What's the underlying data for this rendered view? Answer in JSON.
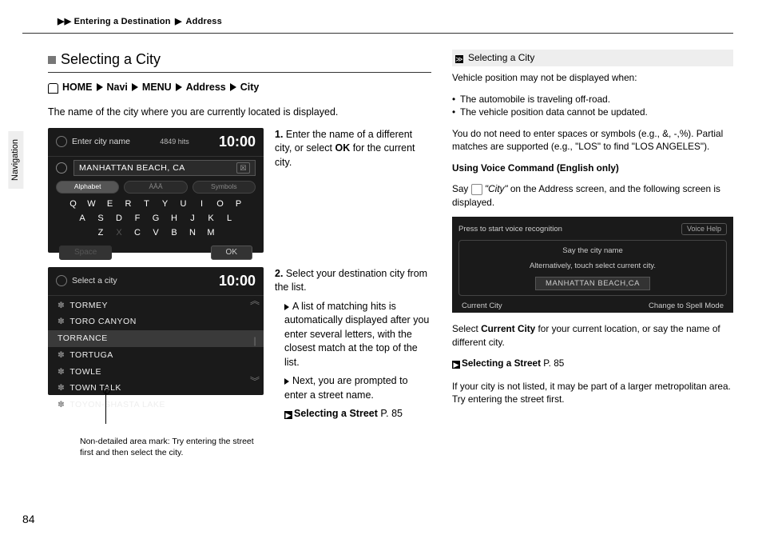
{
  "breadcrumb": {
    "arrow": "▶▶",
    "a": "Entering a Destination",
    "b": "Address",
    "sep": "▶"
  },
  "sidetab": "Navigation",
  "heading": "Selecting a City",
  "nav": {
    "home": "HOME",
    "navi": "Navi",
    "menu": "MENU",
    "addr": "Address",
    "city": "City"
  },
  "intro": "The name of the city where you are currently located is displayed.",
  "screen1": {
    "title": "Enter city name",
    "hits": "4849 hits",
    "time": "10:00",
    "city": "MANHATTAN BEACH, CA",
    "tabs": [
      "Alphabet",
      "ÀÂÄ",
      "Symbols"
    ],
    "row1": [
      "Q",
      "W",
      "E",
      "R",
      "T",
      "Y",
      "U",
      "I",
      "O",
      "P"
    ],
    "row2": [
      "A",
      "S",
      "D",
      "F",
      "G",
      "H",
      "J",
      "K",
      "L"
    ],
    "row3": [
      "Z",
      "X",
      "C",
      "V",
      "B",
      "N",
      "M"
    ],
    "space": "Space",
    "ok": "OK",
    "clear": "☒"
  },
  "step1": {
    "num": "1.",
    "a": "Enter the name of a different city, or select ",
    "b": "OK",
    "c": " for the current city."
  },
  "screen2": {
    "title": "Select a city",
    "time": "10:00",
    "items": [
      "TORMEY",
      "TORO CANYON",
      "TORRANCE",
      "TORTUGA",
      "TOWLE",
      "TOWN TALK",
      "TOYON-SHASTA LAKE"
    ],
    "star": "✽"
  },
  "step2": {
    "num": "2.",
    "a": "Select your destination city from the list.",
    "b": "A list of matching hits is automatically displayed after you enter several letters, with the closest match at the top of the list.",
    "c": "Next, you are prompted to enter a street name.",
    "xref": "Selecting a Street",
    "page": "P. 85"
  },
  "note": "Non-detailed area mark: Try entering the street first and then select the city.",
  "right": {
    "head": "Selecting a City",
    "p1": "Vehicle position may not be displayed when:",
    "bul": [
      "The automobile is traveling off-road.",
      "The vehicle position data cannot be updated."
    ],
    "p2": "You do not need to enter spaces or symbols (e.g., &, -,%). Partial matches are supported (e.g., \"LOS\" to find \"LOS ANGELES\").",
    "voiceHead": "Using Voice Command (English only)",
    "voice1a": "Say ",
    "voice1b": "\"City\"",
    "voice1c": " on the Address screen, and the following screen is displayed.",
    "vshot": {
      "topmsg": "Press      to start voice recognition",
      "help": "Voice Help",
      "say1": "Say the city name",
      "say2": "Alternatively, touch select current city.",
      "city": "MANHATTAN BEACH,CA",
      "cur": "Current City",
      "spell": "Change to Spell Mode"
    },
    "p3a": "Select ",
    "p3b": "Current City",
    "p3c": " for your current location, or say the name of different city.",
    "xref": "Selecting a Street",
    "xpage": "P. 85",
    "p4": "If your city is not listed, it may be part of a larger metropolitan area. Try entering the street first."
  },
  "pageNum": "84"
}
